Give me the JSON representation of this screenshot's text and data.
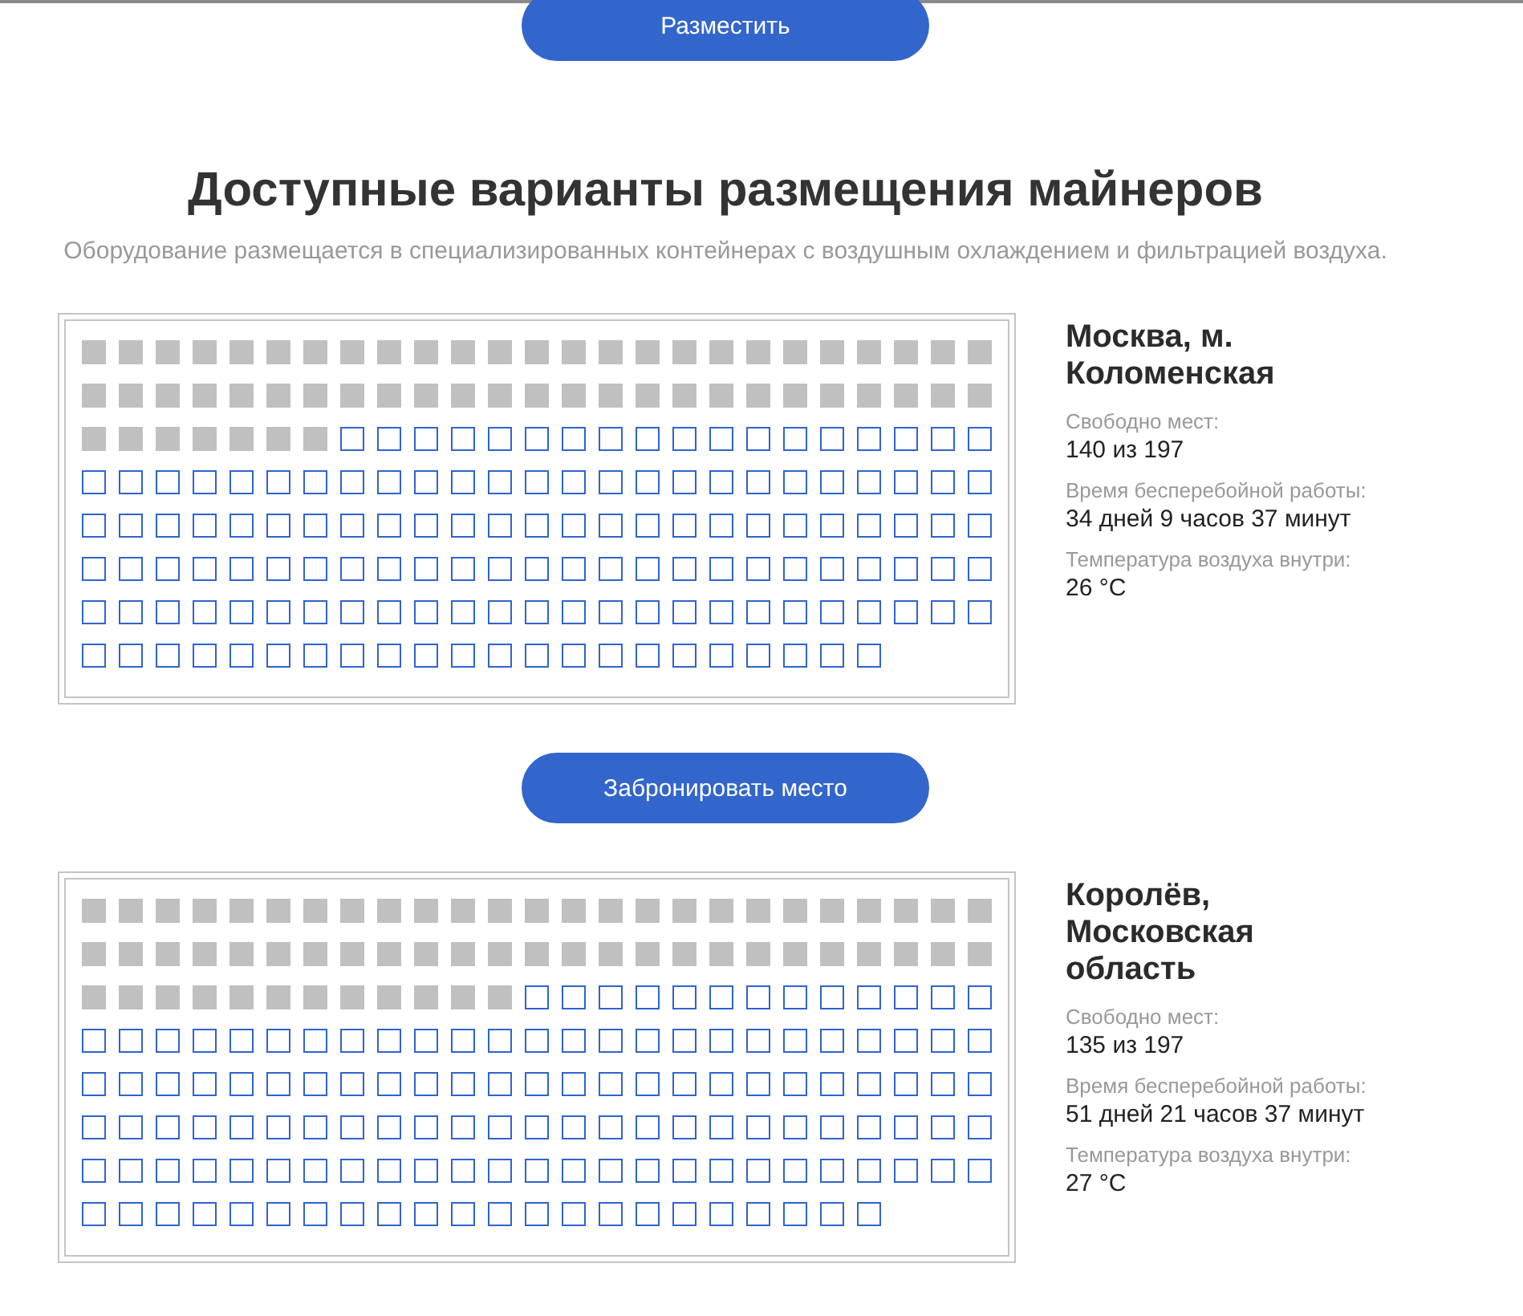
{
  "top_button": {
    "label": "Разместить"
  },
  "heading": "Доступные варианты размещения майнеров",
  "subtitle": "Оборудование размещается в специализированных контейнерах с воздушным охлаждением и фильтрацией воздуха.",
  "locations": [
    {
      "name": "Москва, м. Коломенская",
      "slot_rows": [
        [
          {
            "occupied": true
          },
          {
            "occupied": true
          },
          {
            "occupied": true
          },
          {
            "occupied": true
          },
          {
            "occupied": true
          },
          {
            "occupied": true
          },
          {
            "occupied": true
          },
          {
            "occupied": true
          },
          {
            "occupied": true
          },
          {
            "occupied": true
          },
          {
            "occupied": true
          },
          {
            "occupied": true
          },
          {
            "occupied": true
          },
          {
            "occupied": true
          },
          {
            "occupied": true
          },
          {
            "occupied": true
          },
          {
            "occupied": true
          },
          {
            "occupied": true
          },
          {
            "occupied": true
          },
          {
            "occupied": true
          },
          {
            "occupied": true
          },
          {
            "occupied": true
          },
          {
            "occupied": true
          },
          {
            "occupied": true
          },
          {
            "occupied": true
          }
        ],
        [
          {
            "occupied": true
          },
          {
            "occupied": true
          },
          {
            "occupied": true
          },
          {
            "occupied": true
          },
          {
            "occupied": true
          },
          {
            "occupied": true
          },
          {
            "occupied": true
          },
          {
            "occupied": true
          },
          {
            "occupied": true
          },
          {
            "occupied": true
          },
          {
            "occupied": true
          },
          {
            "occupied": true
          },
          {
            "occupied": true
          },
          {
            "occupied": true
          },
          {
            "occupied": true
          },
          {
            "occupied": true
          },
          {
            "occupied": true
          },
          {
            "occupied": true
          },
          {
            "occupied": true
          },
          {
            "occupied": true
          },
          {
            "occupied": true
          },
          {
            "occupied": true
          },
          {
            "occupied": true
          },
          {
            "occupied": true
          },
          {
            "occupied": true
          }
        ],
        [
          {
            "occupied": true
          },
          {
            "occupied": true
          },
          {
            "occupied": true
          },
          {
            "occupied": true
          },
          {
            "occupied": true
          },
          {
            "occupied": true
          },
          {
            "occupied": true
          },
          {
            "occupied": false
          },
          {
            "occupied": false
          },
          {
            "occupied": false
          },
          {
            "occupied": false
          },
          {
            "occupied": false
          },
          {
            "occupied": false
          },
          {
            "occupied": false
          },
          {
            "occupied": false
          },
          {
            "occupied": false
          },
          {
            "occupied": false
          },
          {
            "occupied": false
          },
          {
            "occupied": false
          },
          {
            "occupied": false
          },
          {
            "occupied": false
          },
          {
            "occupied": false
          },
          {
            "occupied": false
          },
          {
            "occupied": false
          },
          {
            "occupied": false
          }
        ],
        [
          {
            "occupied": false
          },
          {
            "occupied": false
          },
          {
            "occupied": false
          },
          {
            "occupied": false
          },
          {
            "occupied": false
          },
          {
            "occupied": false
          },
          {
            "occupied": false
          },
          {
            "occupied": false
          },
          {
            "occupied": false
          },
          {
            "occupied": false
          },
          {
            "occupied": false
          },
          {
            "occupied": false
          },
          {
            "occupied": false
          },
          {
            "occupied": false
          },
          {
            "occupied": false
          },
          {
            "occupied": false
          },
          {
            "occupied": false
          },
          {
            "occupied": false
          },
          {
            "occupied": false
          },
          {
            "occupied": false
          },
          {
            "occupied": false
          },
          {
            "occupied": false
          },
          {
            "occupied": false
          },
          {
            "occupied": false
          },
          {
            "occupied": false
          }
        ],
        [
          {
            "occupied": false
          },
          {
            "occupied": false
          },
          {
            "occupied": false
          },
          {
            "occupied": false
          },
          {
            "occupied": false
          },
          {
            "occupied": false
          },
          {
            "occupied": false
          },
          {
            "occupied": false
          },
          {
            "occupied": false
          },
          {
            "occupied": false
          },
          {
            "occupied": false
          },
          {
            "occupied": false
          },
          {
            "occupied": false
          },
          {
            "occupied": false
          },
          {
            "occupied": false
          },
          {
            "occupied": false
          },
          {
            "occupied": false
          },
          {
            "occupied": false
          },
          {
            "occupied": false
          },
          {
            "occupied": false
          },
          {
            "occupied": false
          },
          {
            "occupied": false
          },
          {
            "occupied": false
          },
          {
            "occupied": false
          },
          {
            "occupied": false
          }
        ],
        [
          {
            "occupied": false
          },
          {
            "occupied": false
          },
          {
            "occupied": false
          },
          {
            "occupied": false
          },
          {
            "occupied": false
          },
          {
            "occupied": false
          },
          {
            "occupied": false
          },
          {
            "occupied": false
          },
          {
            "occupied": false
          },
          {
            "occupied": false
          },
          {
            "occupied": false
          },
          {
            "occupied": false
          },
          {
            "occupied": false
          },
          {
            "occupied": false
          },
          {
            "occupied": false
          },
          {
            "occupied": false
          },
          {
            "occupied": false
          },
          {
            "occupied": false
          },
          {
            "occupied": false
          },
          {
            "occupied": false
          },
          {
            "occupied": false
          },
          {
            "occupied": false
          },
          {
            "occupied": false
          },
          {
            "occupied": false
          },
          {
            "occupied": false
          }
        ],
        [
          {
            "occupied": false
          },
          {
            "occupied": false
          },
          {
            "occupied": false
          },
          {
            "occupied": false
          },
          {
            "occupied": false
          },
          {
            "occupied": false
          },
          {
            "occupied": false
          },
          {
            "occupied": false
          },
          {
            "occupied": false
          },
          {
            "occupied": false
          },
          {
            "occupied": false
          },
          {
            "occupied": false
          },
          {
            "occupied": false
          },
          {
            "occupied": false
          },
          {
            "occupied": false
          },
          {
            "occupied": false
          },
          {
            "occupied": false
          },
          {
            "occupied": false
          },
          {
            "occupied": false
          },
          {
            "occupied": false
          },
          {
            "occupied": false
          },
          {
            "occupied": false
          },
          {
            "occupied": false
          },
          {
            "occupied": false
          },
          {
            "occupied": false
          }
        ],
        [
          {
            "occupied": false
          },
          {
            "occupied": false
          },
          {
            "occupied": false
          },
          {
            "occupied": false
          },
          {
            "occupied": false
          },
          {
            "occupied": false
          },
          {
            "occupied": false
          },
          {
            "occupied": false
          },
          {
            "occupied": false
          },
          {
            "occupied": false
          },
          {
            "occupied": false
          },
          {
            "occupied": false
          },
          {
            "occupied": false
          },
          {
            "occupied": false
          },
          {
            "occupied": false
          },
          {
            "occupied": false
          },
          {
            "occupied": false
          },
          {
            "occupied": false
          },
          {
            "occupied": false
          },
          {
            "occupied": false
          },
          {
            "occupied": false
          },
          {
            "occupied": false
          }
        ]
      ],
      "free_label": "Свободно мест:",
      "free_value": "140 из 197",
      "uptime_label": "Время бесперебойной работы:",
      "uptime_value": "34 дней 9 часов 37 минут",
      "temp_label": "Температура воздуха внутри:",
      "temp_value": "26 °C",
      "button": "Забронировать место"
    },
    {
      "name": "Королёв, Московская область",
      "slot_rows": [
        [
          {
            "occupied": true
          },
          {
            "occupied": true
          },
          {
            "occupied": true
          },
          {
            "occupied": true
          },
          {
            "occupied": true
          },
          {
            "occupied": true
          },
          {
            "occupied": true
          },
          {
            "occupied": true
          },
          {
            "occupied": true
          },
          {
            "occupied": true
          },
          {
            "occupied": true
          },
          {
            "occupied": true
          },
          {
            "occupied": true
          },
          {
            "occupied": true
          },
          {
            "occupied": true
          },
          {
            "occupied": true
          },
          {
            "occupied": true
          },
          {
            "occupied": true
          },
          {
            "occupied": true
          },
          {
            "occupied": true
          },
          {
            "occupied": true
          },
          {
            "occupied": true
          },
          {
            "occupied": true
          },
          {
            "occupied": true
          },
          {
            "occupied": true
          }
        ],
        [
          {
            "occupied": true
          },
          {
            "occupied": true
          },
          {
            "occupied": true
          },
          {
            "occupied": true
          },
          {
            "occupied": true
          },
          {
            "occupied": true
          },
          {
            "occupied": true
          },
          {
            "occupied": true
          },
          {
            "occupied": true
          },
          {
            "occupied": true
          },
          {
            "occupied": true
          },
          {
            "occupied": true
          },
          {
            "occupied": true
          },
          {
            "occupied": true
          },
          {
            "occupied": true
          },
          {
            "occupied": true
          },
          {
            "occupied": true
          },
          {
            "occupied": true
          },
          {
            "occupied": true
          },
          {
            "occupied": true
          },
          {
            "occupied": true
          },
          {
            "occupied": true
          },
          {
            "occupied": true
          },
          {
            "occupied": true
          },
          {
            "occupied": true
          }
        ],
        [
          {
            "occupied": true
          },
          {
            "occupied": true
          },
          {
            "occupied": true
          },
          {
            "occupied": true
          },
          {
            "occupied": true
          },
          {
            "occupied": true
          },
          {
            "occupied": true
          },
          {
            "occupied": true
          },
          {
            "occupied": true
          },
          {
            "occupied": true
          },
          {
            "occupied": true
          },
          {
            "occupied": true
          },
          {
            "occupied": false
          },
          {
            "occupied": false
          },
          {
            "occupied": false
          },
          {
            "occupied": false
          },
          {
            "occupied": false
          },
          {
            "occupied": false
          },
          {
            "occupied": false
          },
          {
            "occupied": false
          },
          {
            "occupied": false
          },
          {
            "occupied": false
          },
          {
            "occupied": false
          },
          {
            "occupied": false
          },
          {
            "occupied": false
          }
        ],
        [
          {
            "occupied": false
          },
          {
            "occupied": false
          },
          {
            "occupied": false
          },
          {
            "occupied": false
          },
          {
            "occupied": false
          },
          {
            "occupied": false
          },
          {
            "occupied": false
          },
          {
            "occupied": false
          },
          {
            "occupied": false
          },
          {
            "occupied": false
          },
          {
            "occupied": false
          },
          {
            "occupied": false
          },
          {
            "occupied": false
          },
          {
            "occupied": false
          },
          {
            "occupied": false
          },
          {
            "occupied": false
          },
          {
            "occupied": false
          },
          {
            "occupied": false
          },
          {
            "occupied": false
          },
          {
            "occupied": false
          },
          {
            "occupied": false
          },
          {
            "occupied": false
          },
          {
            "occupied": false
          },
          {
            "occupied": false
          },
          {
            "occupied": false
          }
        ],
        [
          {
            "occupied": false
          },
          {
            "occupied": false
          },
          {
            "occupied": false
          },
          {
            "occupied": false
          },
          {
            "occupied": false
          },
          {
            "occupied": false
          },
          {
            "occupied": false
          },
          {
            "occupied": false
          },
          {
            "occupied": false
          },
          {
            "occupied": false
          },
          {
            "occupied": false
          },
          {
            "occupied": false
          },
          {
            "occupied": false
          },
          {
            "occupied": false
          },
          {
            "occupied": false
          },
          {
            "occupied": false
          },
          {
            "occupied": false
          },
          {
            "occupied": false
          },
          {
            "occupied": false
          },
          {
            "occupied": false
          },
          {
            "occupied": false
          },
          {
            "occupied": false
          },
          {
            "occupied": false
          },
          {
            "occupied": false
          },
          {
            "occupied": false
          }
        ],
        [
          {
            "occupied": false
          },
          {
            "occupied": false
          },
          {
            "occupied": false
          },
          {
            "occupied": false
          },
          {
            "occupied": false
          },
          {
            "occupied": false
          },
          {
            "occupied": false
          },
          {
            "occupied": false
          },
          {
            "occupied": false
          },
          {
            "occupied": false
          },
          {
            "occupied": false
          },
          {
            "occupied": false
          },
          {
            "occupied": false
          },
          {
            "occupied": false
          },
          {
            "occupied": false
          },
          {
            "occupied": false
          },
          {
            "occupied": false
          },
          {
            "occupied": false
          },
          {
            "occupied": false
          },
          {
            "occupied": false
          },
          {
            "occupied": false
          },
          {
            "occupied": false
          },
          {
            "occupied": false
          },
          {
            "occupied": false
          },
          {
            "occupied": false
          }
        ],
        [
          {
            "occupied": false
          },
          {
            "occupied": false
          },
          {
            "occupied": false
          },
          {
            "occupied": false
          },
          {
            "occupied": false
          },
          {
            "occupied": false
          },
          {
            "occupied": false
          },
          {
            "occupied": false
          },
          {
            "occupied": false
          },
          {
            "occupied": false
          },
          {
            "occupied": false
          },
          {
            "occupied": false
          },
          {
            "occupied": false
          },
          {
            "occupied": false
          },
          {
            "occupied": false
          },
          {
            "occupied": false
          },
          {
            "occupied": false
          },
          {
            "occupied": false
          },
          {
            "occupied": false
          },
          {
            "occupied": false
          },
          {
            "occupied": false
          },
          {
            "occupied": false
          },
          {
            "occupied": false
          },
          {
            "occupied": false
          },
          {
            "occupied": false
          }
        ],
        [
          {
            "occupied": false
          },
          {
            "occupied": false
          },
          {
            "occupied": false
          },
          {
            "occupied": false
          },
          {
            "occupied": false
          },
          {
            "occupied": false
          },
          {
            "occupied": false
          },
          {
            "occupied": false
          },
          {
            "occupied": false
          },
          {
            "occupied": false
          },
          {
            "occupied": false
          },
          {
            "occupied": false
          },
          {
            "occupied": false
          },
          {
            "occupied": false
          },
          {
            "occupied": false
          },
          {
            "occupied": false
          },
          {
            "occupied": false
          },
          {
            "occupied": false
          },
          {
            "occupied": false
          },
          {
            "occupied": false
          },
          {
            "occupied": false
          },
          {
            "occupied": false
          }
        ]
      ],
      "free_label": "Свободно мест:",
      "free_value": "135 из 197",
      "uptime_label": "Время бесперебойной работы:",
      "uptime_value": "51 дней 21 часов 37 минут",
      "temp_label": "Температура воздуха внутри:",
      "temp_value": "27 °C"
    }
  ]
}
